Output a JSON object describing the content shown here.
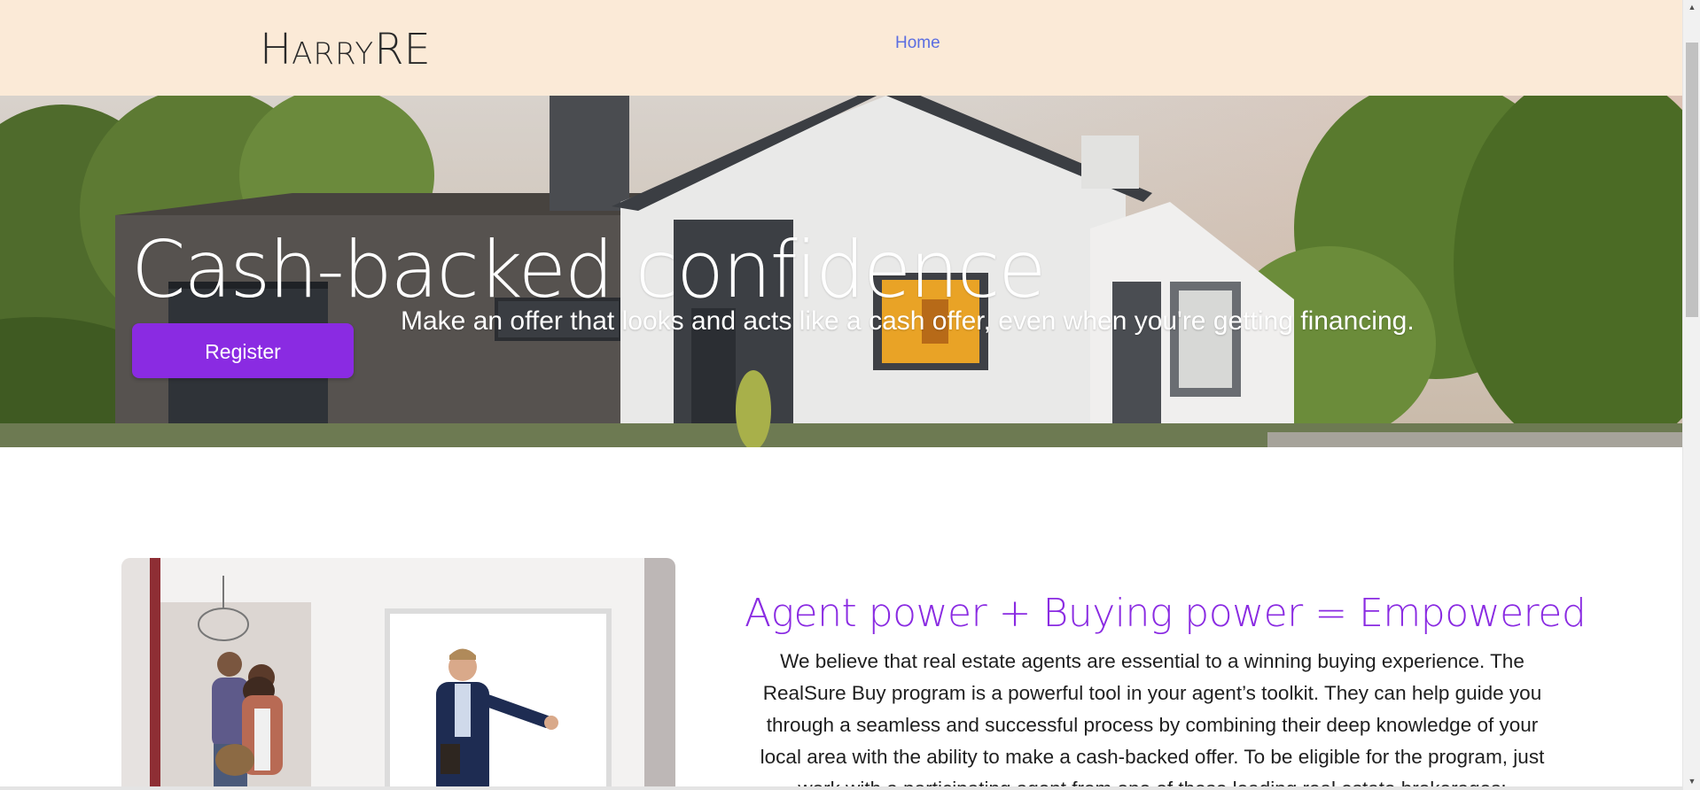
{
  "navbar": {
    "brand_initial": "H",
    "brand_smallcaps": "ARRY",
    "brand_suffix": "RE",
    "home_link": "Home"
  },
  "hero": {
    "title": "Cash-backed confidence",
    "subtitle": "Make an offer that looks and acts like a cash offer, even when you're getting financing.",
    "register_button": "Register"
  },
  "content": {
    "section_title": "Agent power + Buying power = Empowered",
    "section_body": "We believe that real estate agents are essential to a winning buying experience. The RealSure Buy program is a powerful tool in your agent’s toolkit. They can help guide you through a seamless and successful process by combining their deep knowledge of your local area with the ability to make a cash-backed offer. To be eligible for the program, just work with a participating agent from one of these leading real estate brokerages:"
  },
  "colors": {
    "navbar_bg": "#fbead7",
    "accent": "#8a2be2",
    "link": "#5b6ee1"
  },
  "icons": {
    "scroll_up": "triangle-up-icon",
    "scroll_down": "triangle-down-icon"
  }
}
